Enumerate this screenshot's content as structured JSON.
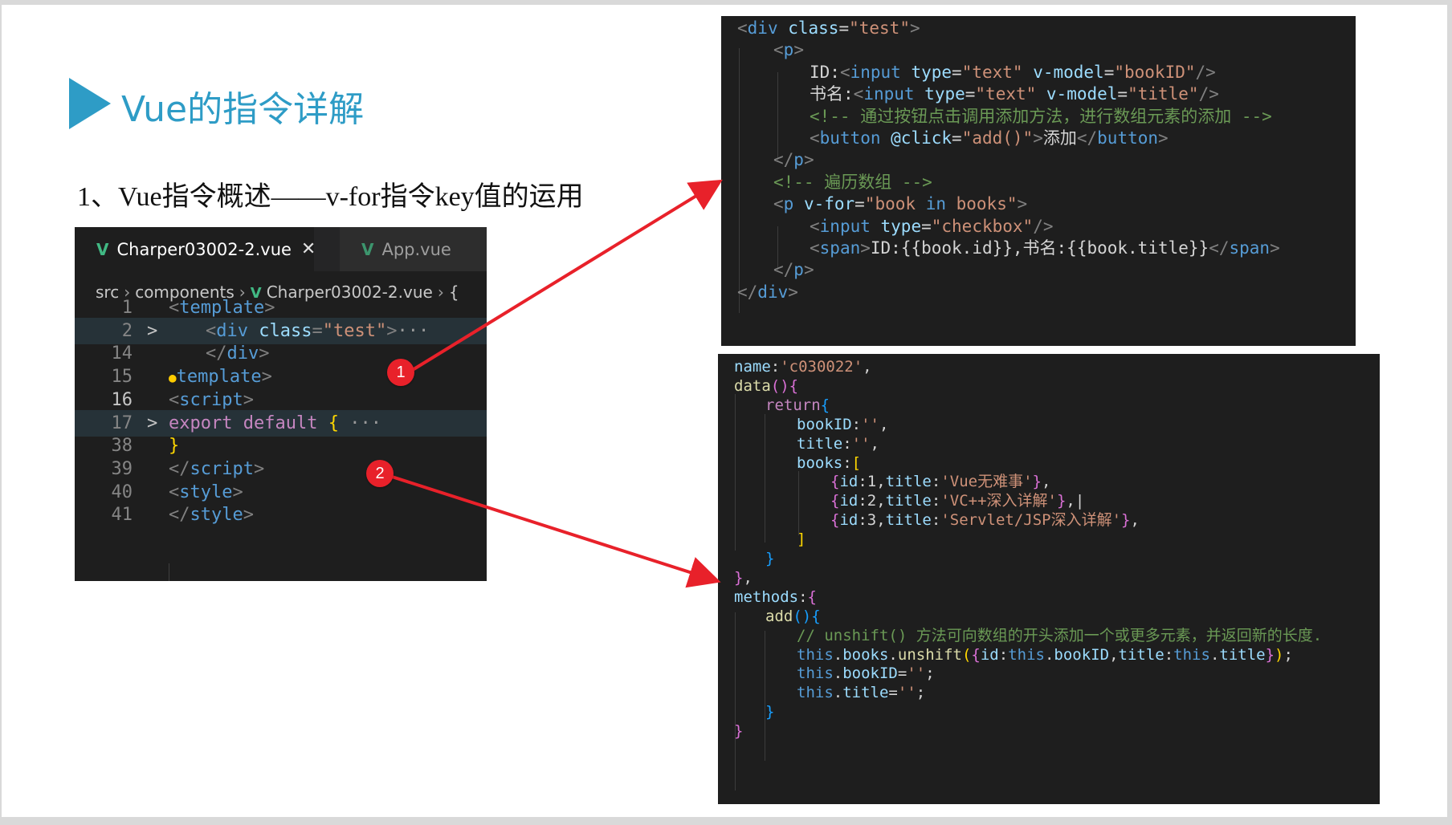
{
  "slide": {
    "title": "Vue的指令详解",
    "subtitle": "1、Vue指令概述——v-for指令key值的运用"
  },
  "editor": {
    "tabs": [
      {
        "label": "Charper03002-2.vue",
        "active": true,
        "close": "✕"
      },
      {
        "label": "App.vue",
        "active": false
      }
    ],
    "breadcrumb": [
      "src",
      "components",
      "Charper03002-2.vue",
      "{"
    ],
    "lines": [
      {
        "num": "1",
        "parts": [
          [
            "tag",
            "<"
          ],
          [
            "tagname",
            "template"
          ],
          [
            "tag",
            ">"
          ]
        ]
      },
      {
        "num": "2",
        "parts": [
          [
            "tag",
            "<"
          ],
          [
            "tagname",
            "div"
          ],
          [
            "attr",
            " class"
          ],
          [
            "pun",
            "="
          ],
          [
            "str",
            "\"test\""
          ],
          [
            "tag",
            ">"
          ],
          [
            "dots",
            "···"
          ]
        ]
      },
      {
        "num": "14",
        "parts": [
          [
            "tag",
            "</"
          ],
          [
            "tagname",
            "div"
          ],
          [
            "tag",
            ">"
          ]
        ]
      },
      {
        "num": "15",
        "parts": [
          [
            "tag",
            ""
          ],
          [
            "tagname",
            "template"
          ],
          [
            "tag",
            ">"
          ]
        ]
      },
      {
        "num": "16",
        "parts": [
          [
            "tag",
            "<"
          ],
          [
            "tagname",
            "script"
          ],
          [
            "tag",
            ">"
          ]
        ]
      },
      {
        "num": "17",
        "parts": [
          [
            "kw",
            "export"
          ],
          [
            "kw",
            " default "
          ],
          [
            "brace",
            "{"
          ],
          [
            "dots",
            " ···"
          ]
        ]
      },
      {
        "num": "38",
        "parts": [
          [
            "brace",
            "}"
          ]
        ]
      },
      {
        "num": "39",
        "parts": [
          [
            "tag",
            "</"
          ],
          [
            "tagname",
            "script"
          ],
          [
            "tag",
            ">"
          ]
        ]
      },
      {
        "num": "40",
        "parts": [
          [
            "tag",
            "<"
          ],
          [
            "tagname",
            "style"
          ],
          [
            "tag",
            ">"
          ]
        ]
      },
      {
        "num": "41",
        "parts": [
          [
            "tag",
            "</"
          ],
          [
            "tagname",
            "style"
          ],
          [
            "tag",
            ">"
          ]
        ]
      }
    ],
    "fold_marker": ">"
  },
  "template_code": [
    {
      "indent": 0,
      "parts": [
        [
          "tag",
          "<"
        ],
        [
          "name",
          "div"
        ],
        [
          "attr",
          " class"
        ],
        [
          "text",
          "="
        ],
        [
          "str",
          "\"test\""
        ],
        [
          "tag",
          ">"
        ]
      ]
    },
    {
      "indent": 1,
      "parts": [
        [
          "tag",
          "<"
        ],
        [
          "name",
          "p"
        ],
        [
          "tag",
          ">"
        ]
      ]
    },
    {
      "indent": 2,
      "parts": [
        [
          "text",
          "ID:"
        ],
        [
          "tag",
          "<"
        ],
        [
          "name",
          "input"
        ],
        [
          "attr",
          " type"
        ],
        [
          "text",
          "="
        ],
        [
          "str",
          "\"text\""
        ],
        [
          "attr",
          " v-model"
        ],
        [
          "text",
          "="
        ],
        [
          "str",
          "\"bookID\""
        ],
        [
          "tag",
          "/>"
        ]
      ]
    },
    {
      "indent": 2,
      "parts": [
        [
          "text",
          "书名:"
        ],
        [
          "tag",
          "<"
        ],
        [
          "name",
          "input"
        ],
        [
          "attr",
          " type"
        ],
        [
          "text",
          "="
        ],
        [
          "str",
          "\"text\""
        ],
        [
          "attr",
          " v-model"
        ],
        [
          "text",
          "="
        ],
        [
          "str",
          "\"title\""
        ],
        [
          "tag",
          "/>"
        ]
      ]
    },
    {
      "indent": 2,
      "parts": [
        [
          "com",
          "<!-- 通过按钮点击调用添加方法，进行数组元素的添加 -->"
        ]
      ]
    },
    {
      "indent": 2,
      "parts": [
        [
          "tag",
          "<"
        ],
        [
          "name",
          "button"
        ],
        [
          "attr",
          " @click"
        ],
        [
          "text",
          "="
        ],
        [
          "str",
          "\"add()\""
        ],
        [
          "tag",
          ">"
        ],
        [
          "text",
          "添加"
        ],
        [
          "tag",
          "</"
        ],
        [
          "name",
          "button"
        ],
        [
          "tag",
          ">"
        ]
      ]
    },
    {
      "indent": 1,
      "parts": [
        [
          "tag",
          "</"
        ],
        [
          "name",
          "p"
        ],
        [
          "tag",
          ">"
        ]
      ]
    },
    {
      "indent": 1,
      "parts": [
        [
          "com",
          "<!-- 遍历数组 -->"
        ]
      ]
    },
    {
      "indent": 1,
      "parts": [
        [
          "tag",
          "<"
        ],
        [
          "name",
          "p"
        ],
        [
          "attr",
          " v-for"
        ],
        [
          "text",
          "="
        ],
        [
          "str",
          "\"book "
        ],
        [
          "name",
          "in"
        ],
        [
          "str",
          " books\""
        ],
        [
          "tag",
          ">"
        ]
      ]
    },
    {
      "indent": 2,
      "parts": [
        [
          "tag",
          "<"
        ],
        [
          "name",
          "input"
        ],
        [
          "attr",
          " type"
        ],
        [
          "text",
          "="
        ],
        [
          "str",
          "\"checkbox\""
        ],
        [
          "tag",
          "/>"
        ]
      ]
    },
    {
      "indent": 2,
      "parts": [
        [
          "tag",
          "<"
        ],
        [
          "name",
          "span"
        ],
        [
          "tag",
          ">"
        ],
        [
          "text",
          "ID:{{book.id}},书名:{{book.title}}"
        ],
        [
          "tag",
          "</"
        ],
        [
          "name",
          "span"
        ],
        [
          "tag",
          ">"
        ]
      ]
    },
    {
      "indent": 1,
      "parts": [
        [
          "tag",
          "</"
        ],
        [
          "name",
          "p"
        ],
        [
          "tag",
          ">"
        ]
      ]
    },
    {
      "indent": 0,
      "parts": [
        [
          "tag",
          "</"
        ],
        [
          "name",
          "div"
        ],
        [
          "tag",
          ">"
        ]
      ]
    }
  ],
  "script_code": [
    {
      "indent": 0,
      "parts": [
        [
          "prop",
          "name"
        ],
        [
          "pun",
          ":"
        ],
        [
          "str",
          "'c030022'"
        ],
        [
          "pun",
          ","
        ]
      ]
    },
    {
      "indent": 0,
      "parts": [
        [
          "fn",
          "data"
        ],
        [
          "b2",
          "()"
        ],
        [
          "b2",
          "{"
        ]
      ]
    },
    {
      "indent": 1,
      "parts": [
        [
          "kw2",
          "return"
        ],
        [
          "b3",
          "{"
        ]
      ]
    },
    {
      "indent": 2,
      "parts": [
        [
          "prop",
          "bookID"
        ],
        [
          "pun",
          ":"
        ],
        [
          "str",
          "''"
        ],
        [
          "pun",
          ","
        ]
      ]
    },
    {
      "indent": 2,
      "parts": [
        [
          "prop",
          "title"
        ],
        [
          "pun",
          ":"
        ],
        [
          "str",
          "''"
        ],
        [
          "pun",
          ","
        ]
      ]
    },
    {
      "indent": 2,
      "parts": [
        [
          "prop",
          "books"
        ],
        [
          "pun",
          ":"
        ],
        [
          "b1",
          "["
        ]
      ]
    },
    {
      "indent": 3,
      "parts": [
        [
          "b2",
          "{"
        ],
        [
          "prop",
          "id"
        ],
        [
          "pun",
          ":1,"
        ],
        [
          "prop",
          "title"
        ],
        [
          "pun",
          ":"
        ],
        [
          "str",
          "'Vue无难事'"
        ],
        [
          "b2",
          "}"
        ],
        [
          "pun",
          ","
        ]
      ]
    },
    {
      "indent": 3,
      "parts": [
        [
          "b2",
          "{"
        ],
        [
          "prop",
          "id"
        ],
        [
          "pun",
          ":2,"
        ],
        [
          "prop",
          "title"
        ],
        [
          "pun",
          ":"
        ],
        [
          "str",
          "'VC++深入详解'"
        ],
        [
          "b2",
          "}"
        ],
        [
          "pun",
          ",|"
        ]
      ]
    },
    {
      "indent": 3,
      "parts": [
        [
          "b2",
          "{"
        ],
        [
          "prop",
          "id"
        ],
        [
          "pun",
          ":3,"
        ],
        [
          "prop",
          "title"
        ],
        [
          "pun",
          ":"
        ],
        [
          "str",
          "'Servlet/JSP深入详解'"
        ],
        [
          "b2",
          "}"
        ],
        [
          "pun",
          ","
        ]
      ]
    },
    {
      "indent": 2,
      "parts": [
        [
          "b1",
          "]"
        ]
      ]
    },
    {
      "indent": 1,
      "parts": [
        [
          "b3",
          "}"
        ]
      ]
    },
    {
      "indent": 0,
      "parts": [
        [
          "b2",
          "}"
        ],
        [
          "pun",
          ","
        ]
      ]
    },
    {
      "indent": 0,
      "parts": [
        [
          "prop",
          "methods"
        ],
        [
          "pun",
          ":"
        ],
        [
          "b2",
          "{"
        ]
      ]
    },
    {
      "indent": 1,
      "parts": [
        [
          "fn",
          "add"
        ],
        [
          "b3",
          "()"
        ],
        [
          "b3",
          "{"
        ]
      ]
    },
    {
      "indent": 2,
      "parts": [
        [
          "com",
          "// unshift() 方法可向数组的开头添加一个或更多元素，并返回新的长度."
        ]
      ]
    },
    {
      "indent": 2,
      "parts": [
        [
          "kw",
          "this"
        ],
        [
          "pun",
          "."
        ],
        [
          "prop",
          "books"
        ],
        [
          "pun",
          "."
        ],
        [
          "fn",
          "unshift"
        ],
        [
          "b1",
          "("
        ],
        [
          "b2",
          "{"
        ],
        [
          "prop",
          "id"
        ],
        [
          "pun",
          ":"
        ],
        [
          "kw",
          "this"
        ],
        [
          "pun",
          "."
        ],
        [
          "prop",
          "bookID"
        ],
        [
          "pun",
          ","
        ],
        [
          "prop",
          "title"
        ],
        [
          "pun",
          ":"
        ],
        [
          "kw",
          "this"
        ],
        [
          "pun",
          "."
        ],
        [
          "prop",
          "title"
        ],
        [
          "b2",
          "}"
        ],
        [
          "b1",
          ")"
        ],
        [
          "pun",
          ";"
        ]
      ]
    },
    {
      "indent": 2,
      "parts": [
        [
          "kw",
          "this"
        ],
        [
          "pun",
          "."
        ],
        [
          "prop",
          "bookID"
        ],
        [
          "pun",
          "="
        ],
        [
          "str",
          "''"
        ],
        [
          "pun",
          ";"
        ]
      ]
    },
    {
      "indent": 2,
      "parts": [
        [
          "kw",
          "this"
        ],
        [
          "pun",
          "."
        ],
        [
          "prop",
          "title"
        ],
        [
          "pun",
          "="
        ],
        [
          "str",
          "''"
        ],
        [
          "pun",
          ";"
        ]
      ]
    },
    {
      "indent": 1,
      "parts": [
        [
          "b3",
          "}"
        ]
      ]
    },
    {
      "indent": 0,
      "parts": [
        [
          "b2",
          "}"
        ]
      ]
    }
  ],
  "badges": [
    "1",
    "2"
  ],
  "colors": {
    "accent": "#2e9cc6",
    "arrow": "#e8212a",
    "editor_bg": "#1e1e1e"
  }
}
